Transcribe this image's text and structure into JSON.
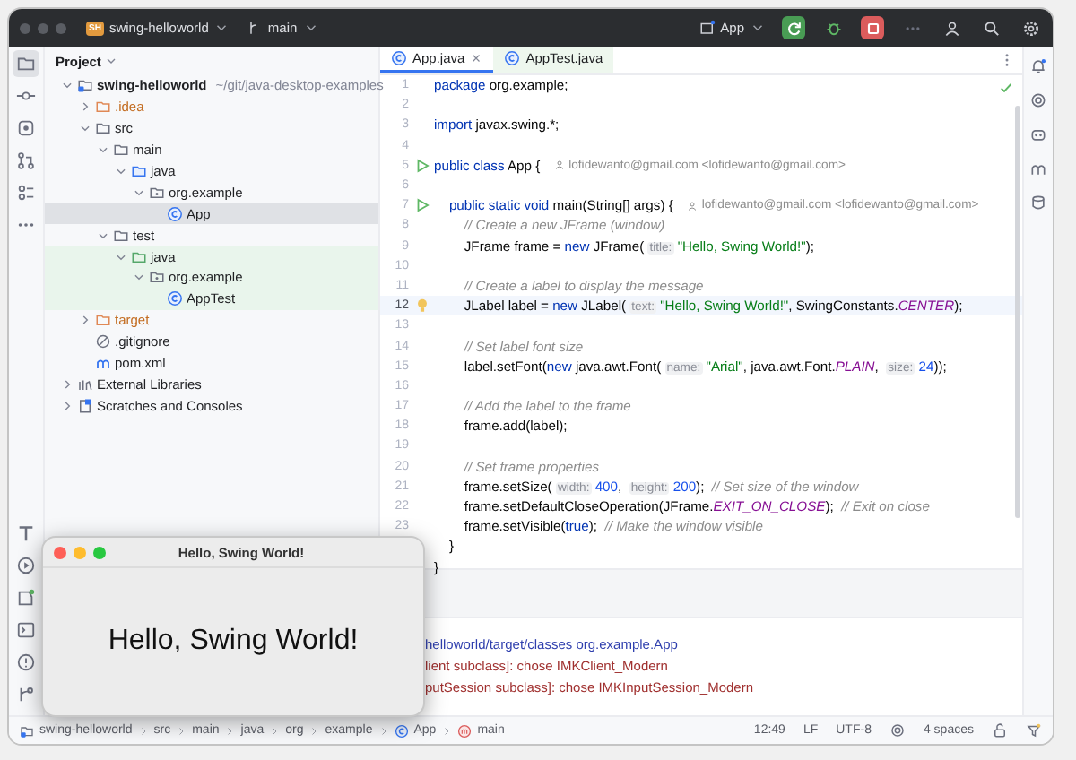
{
  "title_bar": {
    "project_badge": "SH",
    "project": "swing-helloworld",
    "branch": "main",
    "run_config": "App",
    "actions": [
      {
        "kind": "rerun"
      },
      {
        "kind": "debug"
      },
      {
        "kind": "stop"
      },
      {
        "kind": "more"
      },
      {
        "kind": "account"
      },
      {
        "kind": "search"
      },
      {
        "kind": "settings"
      }
    ]
  },
  "left_strip": {
    "top": [
      {
        "kind": "project",
        "selected": true
      },
      {
        "kind": "commit",
        "selected": false
      },
      {
        "kind": "plugins",
        "selected": false
      },
      {
        "kind": "pull-requests",
        "selected": false
      },
      {
        "kind": "structure",
        "selected": false
      },
      {
        "kind": "more",
        "selected": false
      }
    ],
    "bottom": [
      {
        "kind": "build",
        "selected": false
      },
      {
        "kind": "run",
        "selected": false
      },
      {
        "kind": "services",
        "selected": false
      },
      {
        "kind": "terminal",
        "selected": false
      },
      {
        "kind": "problems",
        "selected": false
      },
      {
        "kind": "git",
        "selected": false
      }
    ]
  },
  "right_strip": [
    {
      "kind": "notifications"
    },
    {
      "kind": "ai"
    },
    {
      "kind": "copilot"
    },
    {
      "kind": "maven"
    },
    {
      "kind": "database"
    }
  ],
  "project": {
    "title": "Project",
    "tree": [
      {
        "label": "swing-helloworld",
        "path": "~/git/java-desktop-examples",
        "kind": "module",
        "excluded": false,
        "test": false,
        "selected": false,
        "expanded": true,
        "children": [
          {
            "label": ".idea",
            "kind": "folder",
            "excluded": true,
            "test": false,
            "selected": false,
            "expanded": false
          },
          {
            "label": "src",
            "kind": "folder",
            "excluded": false,
            "test": false,
            "selected": false,
            "expanded": true,
            "children": [
              {
                "label": "main",
                "kind": "folder",
                "excluded": false,
                "test": false,
                "selected": false,
                "expanded": true,
                "children": [
                  {
                    "label": "java",
                    "kind": "source-folder",
                    "excluded": false,
                    "test": false,
                    "selected": false,
                    "expanded": true,
                    "children": [
                      {
                        "label": "org.example",
                        "kind": "package",
                        "excluded": false,
                        "test": false,
                        "selected": false,
                        "expanded": true,
                        "children": [
                          {
                            "label": "App",
                            "kind": "class",
                            "excluded": false,
                            "test": false,
                            "selected": true
                          }
                        ]
                      }
                    ]
                  }
                ]
              },
              {
                "label": "test",
                "kind": "folder",
                "excluded": false,
                "test": false,
                "selected": false,
                "expanded": true,
                "children": [
                  {
                    "label": "java",
                    "kind": "source-folder",
                    "excluded": false,
                    "test": true,
                    "selected": false,
                    "expanded": true,
                    "children": [
                      {
                        "label": "org.example",
                        "kind": "package",
                        "excluded": false,
                        "test": true,
                        "selected": false,
                        "expanded": true,
                        "children": [
                          {
                            "label": "AppTest",
                            "kind": "class",
                            "excluded": false,
                            "test": true,
                            "selected": false
                          }
                        ]
                      }
                    ]
                  }
                ]
              }
            ]
          },
          {
            "label": "target",
            "kind": "folder",
            "excluded": true,
            "test": false,
            "selected": false,
            "expanded": false
          },
          {
            "label": ".gitignore",
            "kind": "ignore",
            "excluded": false,
            "test": false,
            "selected": false
          },
          {
            "label": "pom.xml",
            "kind": "maven",
            "excluded": false,
            "test": false,
            "selected": false
          }
        ]
      },
      {
        "label": "External Libraries",
        "kind": "library",
        "excluded": false,
        "test": false,
        "selected": false,
        "expanded": false
      },
      {
        "label": "Scratches and Consoles",
        "kind": "scratches",
        "excluded": false,
        "test": false,
        "selected": false,
        "expanded": false
      }
    ]
  },
  "tabs": [
    {
      "label": "App.java",
      "selected": true
    },
    {
      "label": "AppTest.java",
      "selected": false
    }
  ],
  "editor": {
    "lines": [
      {
        "number": "1",
        "current": false,
        "runnable": false,
        "intention": false,
        "tokens": [
          {
            "kind": "keyword",
            "text": "package"
          },
          {
            "kind": "plain",
            "text": " org.example;"
          }
        ]
      },
      {
        "number": "2",
        "current": false,
        "runnable": false,
        "intention": false
      },
      {
        "number": "3",
        "current": false,
        "runnable": false,
        "intention": false,
        "tokens": [
          {
            "kind": "keyword",
            "text": "import"
          },
          {
            "kind": "plain",
            "text": " javax.swing.*;"
          }
        ]
      },
      {
        "number": "4",
        "current": false,
        "runnable": false,
        "intention": false
      },
      {
        "number": "5",
        "current": false,
        "runnable": true,
        "intention": false,
        "tokens": [
          {
            "kind": "keyword",
            "text": "public class"
          },
          {
            "kind": "plain",
            "text": " App {"
          }
        ],
        "author": "lofidewanto@gmail.com <lofidewanto@gmail.com>"
      },
      {
        "number": "6",
        "current": false,
        "runnable": false,
        "intention": false
      },
      {
        "number": "7",
        "current": false,
        "runnable": true,
        "intention": false,
        "tokens": [
          {
            "kind": "keyword",
            "text": "    public static void"
          },
          {
            "kind": "plain",
            "text": " main(String[] args) {"
          }
        ],
        "author": "lofidewanto@gmail.com <lofidewanto@gmail.com>"
      },
      {
        "number": "8",
        "current": false,
        "runnable": false,
        "intention": false,
        "tokens": [
          {
            "kind": "comment",
            "text": "        // Create a new JFrame (window)"
          }
        ]
      },
      {
        "number": "9",
        "current": false,
        "runnable": false,
        "intention": false,
        "tokens": [
          {
            "kind": "plain",
            "text": "        JFrame frame = "
          },
          {
            "kind": "keyword",
            "text": "new"
          },
          {
            "kind": "plain",
            "text": " JFrame( "
          },
          {
            "kind": "hint",
            "text": "title:"
          },
          {
            "kind": "string",
            "text": " \"Hello, Swing World!\""
          },
          {
            "kind": "plain",
            "text": ");"
          }
        ]
      },
      {
        "number": "10",
        "current": false,
        "runnable": false,
        "intention": false
      },
      {
        "number": "11",
        "current": false,
        "runnable": false,
        "intention": false,
        "tokens": [
          {
            "kind": "comment",
            "text": "        // Create a label to display the message"
          }
        ]
      },
      {
        "number": "12",
        "current": true,
        "runnable": false,
        "intention": true,
        "tokens": [
          {
            "kind": "plain",
            "text": "        JLabel label = "
          },
          {
            "kind": "keyword",
            "text": "new"
          },
          {
            "kind": "plain",
            "text": " JLabel( "
          },
          {
            "kind": "hint",
            "text": "text:"
          },
          {
            "kind": "string",
            "text": " \"Hello, Swing World!\""
          },
          {
            "kind": "plain",
            "text": ", SwingConstants."
          },
          {
            "kind": "constant",
            "text": "CENTER"
          },
          {
            "kind": "plain",
            "text": ");"
          }
        ]
      },
      {
        "number": "13",
        "current": false,
        "runnable": false,
        "intention": false
      },
      {
        "number": "14",
        "current": false,
        "runnable": false,
        "intention": false,
        "tokens": [
          {
            "kind": "comment",
            "text": "        // Set label font size"
          }
        ]
      },
      {
        "number": "15",
        "current": false,
        "runnable": false,
        "intention": false,
        "tokens": [
          {
            "kind": "plain",
            "text": "        label.setFont("
          },
          {
            "kind": "keyword",
            "text": "new"
          },
          {
            "kind": "plain",
            "text": " java.awt.Font( "
          },
          {
            "kind": "hint",
            "text": "name:"
          },
          {
            "kind": "string",
            "text": " \"Arial\""
          },
          {
            "kind": "plain",
            "text": ", java.awt.Font."
          },
          {
            "kind": "constant",
            "text": "PLAIN"
          },
          {
            "kind": "plain",
            "text": ",  "
          },
          {
            "kind": "hint",
            "text": "size:"
          },
          {
            "kind": "number",
            "text": " 24"
          },
          {
            "kind": "plain",
            "text": "));"
          }
        ]
      },
      {
        "number": "16",
        "current": false,
        "runnable": false,
        "intention": false
      },
      {
        "number": "17",
        "current": false,
        "runnable": false,
        "intention": false,
        "tokens": [
          {
            "kind": "comment",
            "text": "        // Add the label to the frame"
          }
        ]
      },
      {
        "number": "18",
        "current": false,
        "runnable": false,
        "intention": false,
        "tokens": [
          {
            "kind": "plain",
            "text": "        frame.add(label);"
          }
        ]
      },
      {
        "number": "19",
        "current": false,
        "runnable": false,
        "intention": false
      },
      {
        "number": "20",
        "current": false,
        "runnable": false,
        "intention": false,
        "tokens": [
          {
            "kind": "comment",
            "text": "        // Set frame properties"
          }
        ]
      },
      {
        "number": "21",
        "current": false,
        "runnable": false,
        "intention": false,
        "tokens": [
          {
            "kind": "plain",
            "text": "        frame.setSize( "
          },
          {
            "kind": "hint",
            "text": "width:"
          },
          {
            "kind": "number",
            "text": " 400"
          },
          {
            "kind": "plain",
            "text": ",  "
          },
          {
            "kind": "hint",
            "text": "height:"
          },
          {
            "kind": "number",
            "text": " 200"
          },
          {
            "kind": "plain",
            "text": ");  "
          },
          {
            "kind": "comment",
            "text": "// Set size of the window"
          }
        ]
      },
      {
        "number": "22",
        "current": false,
        "runnable": false,
        "intention": false,
        "tokens": [
          {
            "kind": "plain",
            "text": "        frame.setDefaultCloseOperation(JFrame."
          },
          {
            "kind": "constant",
            "text": "EXIT_ON_CLOSE"
          },
          {
            "kind": "plain",
            "text": ");  "
          },
          {
            "kind": "comment",
            "text": "// Exit on close"
          }
        ]
      },
      {
        "number": "23",
        "current": false,
        "runnable": false,
        "intention": false,
        "tokens": [
          {
            "kind": "plain",
            "text": "        frame.setVisible("
          },
          {
            "kind": "keyword",
            "text": "true"
          },
          {
            "kind": "plain",
            "text": ");  "
          },
          {
            "kind": "comment",
            "text": "// Make the window visible"
          }
        ]
      },
      {
        "current": false,
        "runnable": false,
        "intention": false,
        "tokens": [
          {
            "kind": "plain",
            "text": "    }"
          }
        ]
      },
      {
        "current": false,
        "runnable": false,
        "intention": false,
        "tokens": [
          {
            "kind": "plain",
            "text": "}"
          }
        ]
      }
    ]
  },
  "console": {
    "lines": [
      {
        "kind": "info",
        "text": "helloworld/target/classes org.example.App"
      },
      {
        "kind": "error",
        "text": "lient subclass]: chose IMKClient_Modern"
      },
      {
        "kind": "error",
        "text": "putSession subclass]: chose IMKInputSession_Modern"
      }
    ]
  },
  "status_bar": {
    "breadcrumbs": [
      {
        "label": "swing-helloworld",
        "kind": "module"
      },
      {
        "label": "src"
      },
      {
        "label": "main"
      },
      {
        "label": "java"
      },
      {
        "label": "org"
      },
      {
        "label": "example"
      },
      {
        "label": "App",
        "kind": "class"
      },
      {
        "label": "main",
        "kind": "method"
      }
    ],
    "items": [
      {
        "kind": "text",
        "text": "12:49"
      },
      {
        "kind": "text",
        "text": "LF"
      },
      {
        "kind": "text",
        "text": "UTF-8"
      },
      {
        "kind": "ai"
      },
      {
        "kind": "text",
        "text": "4 spaces"
      },
      {
        "kind": "lock"
      },
      {
        "kind": "filter"
      }
    ]
  },
  "swing_window": {
    "title": "Hello, Swing World!",
    "label": "Hello, Swing World!"
  }
}
